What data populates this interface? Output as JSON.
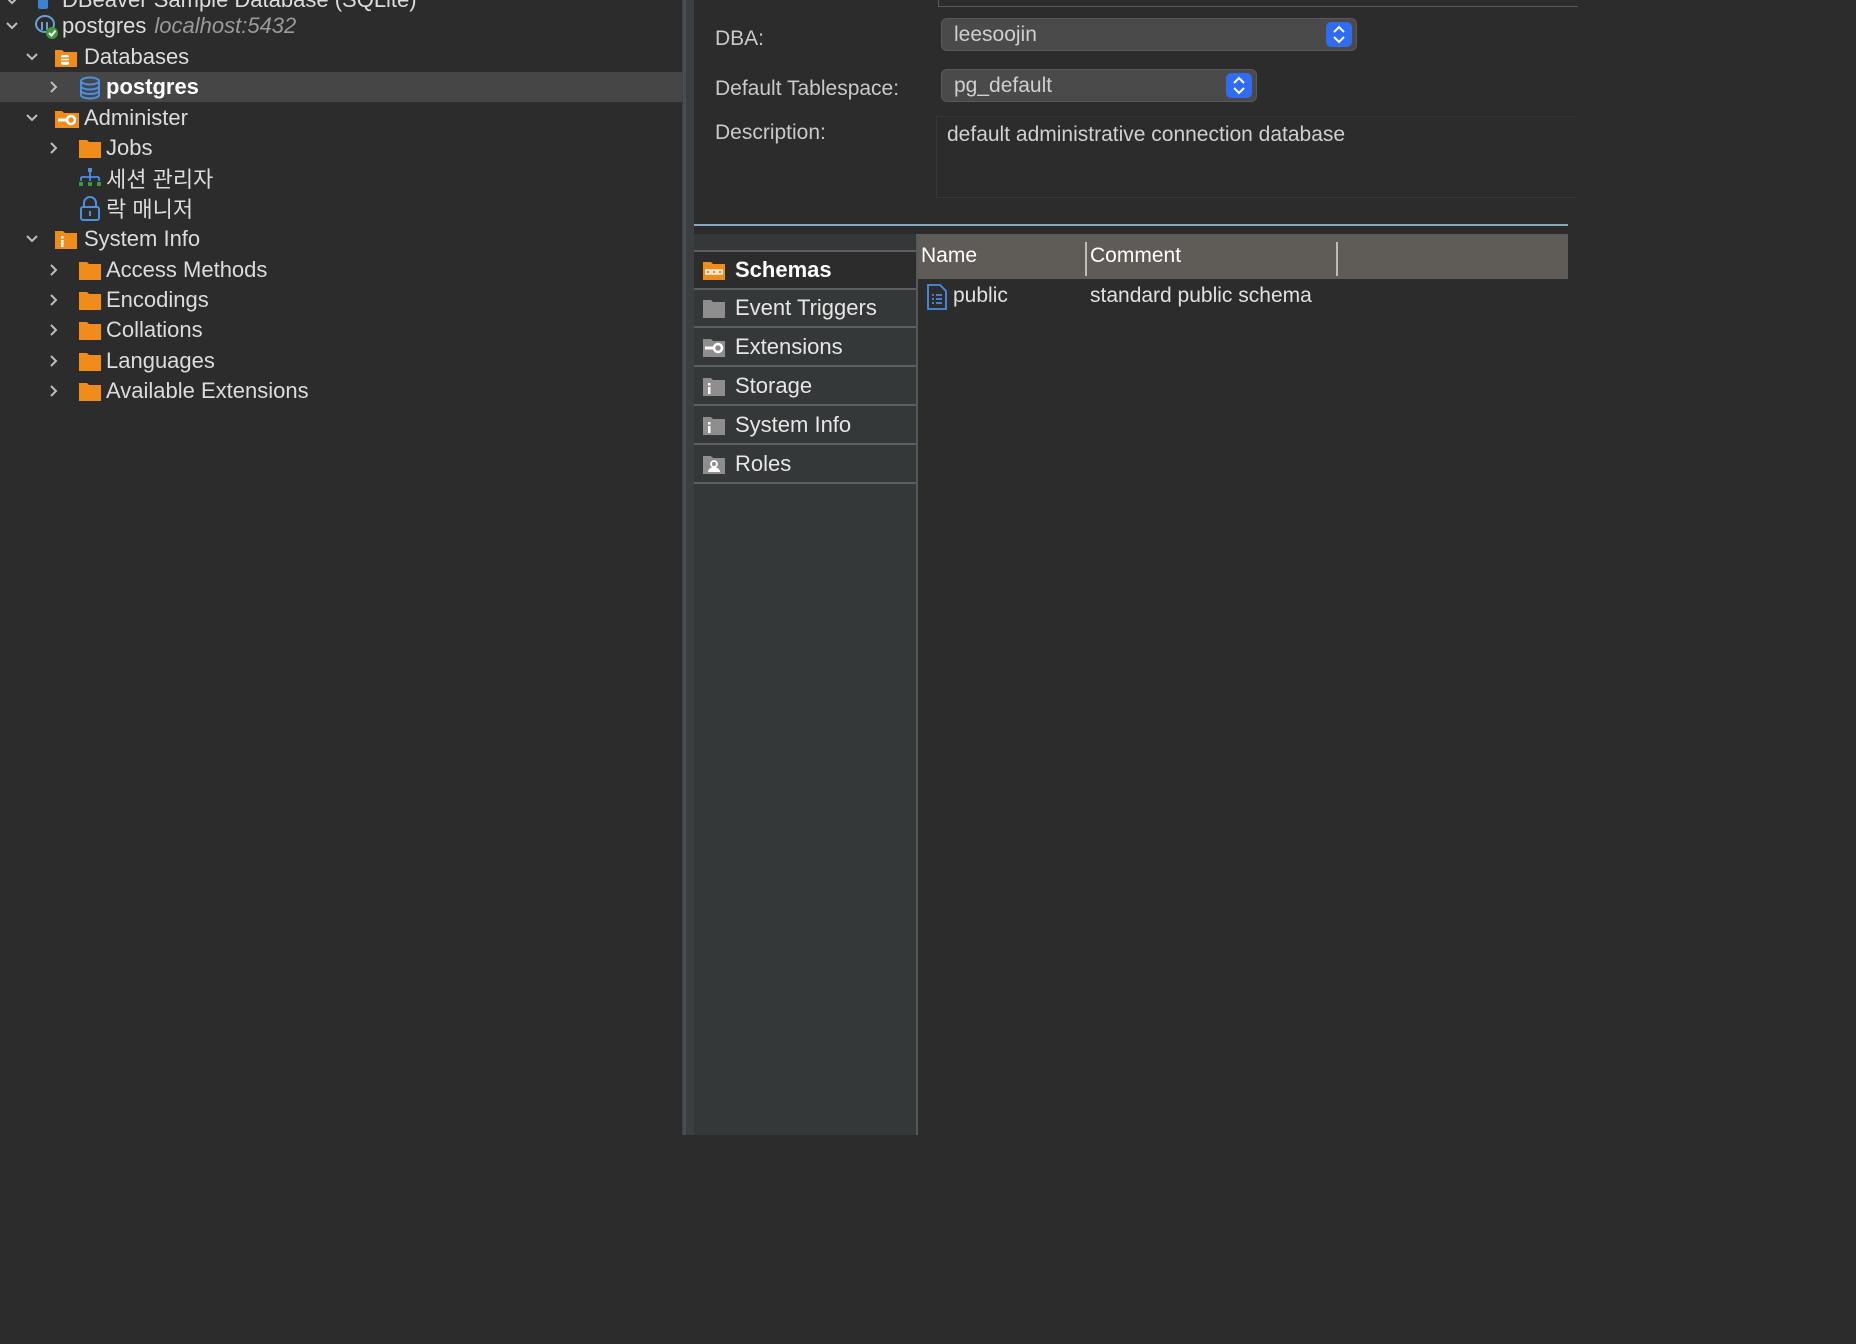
{
  "navigator": {
    "items": [
      {
        "label": "DBeaver Sample Database (SQLite)",
        "icon": "sqlite-database-icon"
      },
      {
        "label": "postgres",
        "host": "localhost:5432",
        "icon": "postgres-connection-icon"
      },
      {
        "label": "Databases",
        "icon": "databases-folder-icon"
      },
      {
        "label": "postgres",
        "icon": "database-icon",
        "selected": true
      },
      {
        "label": "Administer",
        "icon": "administer-folder-icon"
      },
      {
        "label": "Jobs",
        "icon": "folder-icon"
      },
      {
        "label": "세션 관리자",
        "icon": "session-manager-icon"
      },
      {
        "label": "락 매니저",
        "icon": "lock-manager-icon"
      },
      {
        "label": "System Info",
        "icon": "system-info-folder-icon"
      },
      {
        "label": "Access Methods",
        "icon": "folder-icon"
      },
      {
        "label": "Encodings",
        "icon": "folder-icon"
      },
      {
        "label": "Collations",
        "icon": "folder-icon"
      },
      {
        "label": "Languages",
        "icon": "folder-icon"
      },
      {
        "label": "Available Extensions",
        "icon": "folder-icon"
      }
    ]
  },
  "properties": {
    "dba_label": "DBA:",
    "dba_value": "leesoojin",
    "tablespace_label": "Default Tablespace:",
    "tablespace_value": "pg_default",
    "description_label": "Description:",
    "description_value": "default administrative connection database"
  },
  "tabs": [
    {
      "label": "Schemas",
      "icon": "schemas-icon",
      "active": true
    },
    {
      "label": "Event Triggers",
      "icon": "folder-icon"
    },
    {
      "label": "Extensions",
      "icon": "extensions-icon"
    },
    {
      "label": "Storage",
      "icon": "info-folder-icon"
    },
    {
      "label": "System Info",
      "icon": "info-folder-icon"
    },
    {
      "label": "Roles",
      "icon": "roles-icon"
    }
  ],
  "grid": {
    "columns": [
      "Name",
      "Comment"
    ],
    "rows": [
      {
        "name": "public",
        "comment": "standard public schema"
      }
    ]
  },
  "colors": {
    "accent_blue": "#2f6cf2",
    "folder_orange": "#f08c1a",
    "background": "#2c2c2c"
  }
}
